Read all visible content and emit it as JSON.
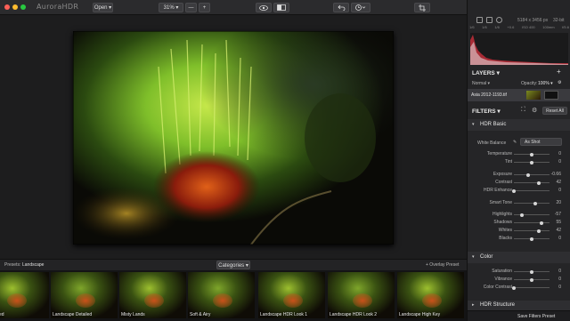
{
  "app": {
    "name": "AuroraHDR"
  },
  "toolbar": {
    "open_label": "Open ▾",
    "zoom_label": "31% ▾",
    "zoom_out": "—",
    "zoom_in": "+"
  },
  "image_info": {
    "dimensions": "5184 x 3456 px",
    "bit_depth": "32-bit",
    "exif": [
      "1/6",
      "1/6",
      "1/6",
      "+0.6",
      "ISO 400",
      "100mm",
      "f/5.6"
    ]
  },
  "layers": {
    "title": "LAYERS ▾",
    "blend_mode": "Normal ▾",
    "opacity_label": "Opacity:",
    "opacity_value": "100% ▾",
    "layer_name": "Asia 2012-1193.tif"
  },
  "filters": {
    "title": "FILTERS ▾",
    "reset_label": "Reset All"
  },
  "hdr_basic": {
    "title": "HDR Basic",
    "white_balance_label": "White Balance",
    "white_balance_value": "As Shot",
    "sliders": [
      {
        "label": "Temperature",
        "value": "0",
        "pos": 0.5
      },
      {
        "label": "Tint",
        "value": "0",
        "pos": 0.5
      },
      {
        "label": "Exposure",
        "value": "-0.66",
        "pos": 0.41
      },
      {
        "label": "Contrast",
        "value": "42",
        "pos": 0.71
      },
      {
        "label": "HDR Enhance",
        "value": "0",
        "pos": 0.0
      },
      {
        "label": "Smart Tone",
        "value": "20",
        "pos": 0.6
      },
      {
        "label": "Highlights",
        "value": "-57",
        "pos": 0.22
      },
      {
        "label": "Shadows",
        "value": "55",
        "pos": 0.78
      },
      {
        "label": "Whites",
        "value": "42",
        "pos": 0.71
      },
      {
        "label": "Blacks",
        "value": "0",
        "pos": 0.5
      }
    ]
  },
  "color": {
    "title": "Color",
    "sliders": [
      {
        "label": "Saturation",
        "value": "0",
        "pos": 0.5
      },
      {
        "label": "Vibrance",
        "value": "0",
        "pos": 0.5
      },
      {
        "label": "Color Contrast",
        "value": "0",
        "pos": 0.0
      }
    ]
  },
  "hdr_structure": {
    "title": "HDR Structure"
  },
  "presets": {
    "label": "Presets:",
    "category": "Landscape",
    "categories_label": "Categories ▾",
    "overlay_label": "+ Overlay Preset",
    "save_label": "Save Filters Preset",
    "items": [
      "Enhanced",
      "Landscape Detailed",
      "Misty Lands",
      "Soft & Airy",
      "Landscape HDR Look 1",
      "Landscape HDR Look 2",
      "Landscape High Key"
    ]
  },
  "colors": {
    "accent": "#f0a000",
    "panel": "#252527",
    "canvas": "#1d1d1e"
  }
}
